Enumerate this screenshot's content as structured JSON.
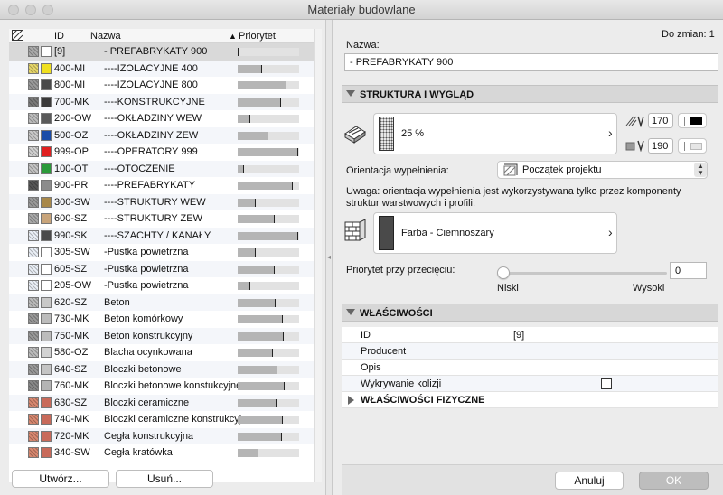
{
  "window": {
    "title": "Materiały budowlane"
  },
  "list": {
    "header": {
      "id": "ID",
      "name": "Nazwa",
      "priority": "Priorytet",
      "sort_arrow": "▲"
    },
    "rows": [
      {
        "sw1": "#aaaaaa",
        "sw2": "#ffffff",
        "id": "[9]",
        "name": "- PREFABRYKATY 900",
        "p": 0.02,
        "selected": true
      },
      {
        "sw1": "#e6d66a",
        "sw2": "#f0e020",
        "id": "400-MI",
        "name": "----IZOLACYJNE 400",
        "p": 0.4
      },
      {
        "sw1": "#9a9a9a",
        "sw2": "#4a4a4a",
        "id": "800-MI",
        "name": "----IZOLACYJNE 800",
        "p": 0.8
      },
      {
        "sw1": "#7a7a7a",
        "sw2": "#3a3a3a",
        "id": "700-MK",
        "name": "----KONSTRUKCYJNE",
        "p": 0.7
      },
      {
        "sw1": "#bcbcbc",
        "sw2": "#5a5a5a",
        "id": "200-OW",
        "name": "----OKŁADZINY WEW",
        "p": 0.2
      },
      {
        "sw1": "#c8c8c8",
        "sw2": "#1a4ca8",
        "id": "500-OZ",
        "name": "----OKŁADZINY ZEW",
        "p": 0.5
      },
      {
        "sw1": "#d0d0d0",
        "sw2": "#e02020",
        "id": "999-OP",
        "name": "----OPERATORY 999",
        "p": 0.99
      },
      {
        "sw1": "#c4c4c4",
        "sw2": "#2a9a3a",
        "id": "100-OT",
        "name": "----OTOCZENIE",
        "p": 0.1
      },
      {
        "sw1": "#555555",
        "sw2": "#8c8c8c",
        "id": "900-PR",
        "name": "----PREFABRYKATY",
        "p": 0.9
      },
      {
        "sw1": "#9a9a9a",
        "sw2": "#a8884a",
        "id": "300-SW",
        "name": "----STRUKTURY WEW",
        "p": 0.3
      },
      {
        "sw1": "#aaaaaa",
        "sw2": "#c8a47a",
        "id": "600-SZ",
        "name": "----STRUKTURY ZEW",
        "p": 0.6
      },
      {
        "sw1": "#eaeff6",
        "sw2": "#4a4a4a",
        "id": "990-SK",
        "name": "----SZACHTY / KANAŁY",
        "p": 0.99
      },
      {
        "sw1": "#eaeff6",
        "sw2": "#ffffff",
        "id": "305-SW",
        "name": "-Pustka powietrzna",
        "p": 0.3
      },
      {
        "sw1": "#eaeff6",
        "sw2": "#ffffff",
        "id": "605-SZ",
        "name": "-Pustka powietrzna",
        "p": 0.6
      },
      {
        "sw1": "#eaeff6",
        "sw2": "#ffffff",
        "id": "205-OW",
        "name": "-Pustka powietrzna",
        "p": 0.2
      },
      {
        "sw1": "#bbbbbb",
        "sw2": "#c8c8c8",
        "id": "620-SZ",
        "name": "Beton",
        "p": 0.62
      },
      {
        "sw1": "#999999",
        "sw2": "#bcbcbc",
        "id": "730-MK",
        "name": "Beton komórkowy",
        "p": 0.73
      },
      {
        "sw1": "#999999",
        "sw2": "#bcbcbc",
        "id": "750-MK",
        "name": "Beton konstrukcyjny",
        "p": 0.75
      },
      {
        "sw1": "#bdbdbd",
        "sw2": "#d2d2d2",
        "id": "580-OZ",
        "name": "Blacha ocynkowana",
        "p": 0.58
      },
      {
        "sw1": "#9a9a9a",
        "sw2": "#c4c4c4",
        "id": "640-SZ",
        "name": "Bloczki betonowe",
        "p": 0.64
      },
      {
        "sw1": "#888888",
        "sw2": "#b4b4b4",
        "id": "760-MK",
        "name": "Bloczki betonowe konstukcyjne",
        "p": 0.76
      },
      {
        "sw1": "#d88870",
        "sw2": "#c86a5a",
        "id": "630-SZ",
        "name": "Bloczki ceramiczne",
        "p": 0.63
      },
      {
        "sw1": "#d88870",
        "sw2": "#c86a5a",
        "id": "740-MK",
        "name": "Bloczki ceramiczne konstrukcyjne",
        "p": 0.74
      },
      {
        "sw1": "#d88870",
        "sw2": "#c86a5a",
        "id": "720-MK",
        "name": "Cegła konstrukcyjna",
        "p": 0.72
      },
      {
        "sw1": "#d88870",
        "sw2": "#c86a5a",
        "id": "340-SW",
        "name": "Cegła kratówka",
        "p": 0.34
      }
    ]
  },
  "buttons": {
    "create": "Utwórz...",
    "delete": "Usuń...",
    "cancel": "Anuluj",
    "ok": "OK"
  },
  "details": {
    "changes": "Do zmian: 1",
    "name_label": "Nazwa:",
    "name_value": "- PREFABRYKATY 900",
    "section_structure": "STRUKTURA I WYGLĄD",
    "fill_percent": "25 %",
    "pen1": "170",
    "pen2": "190",
    "orientation_label": "Orientacja wypełnienia:",
    "orientation_value": "Początek projektu",
    "note": "Uwaga: orientacja wypełnienia jest wykorzystywana tylko przez komponenty struktur warstwowych i profili.",
    "surface_value": "Farba - Ciemnoszary",
    "priority_label": "Priorytet przy przecięciu:",
    "priority_value": "0",
    "slider_low": "Niski",
    "slider_high": "Wysoki",
    "slider_level": 0.0,
    "section_props": "WŁAŚCIWOŚCI",
    "props": [
      {
        "label": "ID",
        "value": "[9]"
      },
      {
        "label": "Producent",
        "value": ""
      },
      {
        "label": "Opis",
        "value": ""
      },
      {
        "label": "Wykrywanie kolizji",
        "value": ""
      }
    ],
    "section_physical": "WŁAŚCIWOŚCI FIZYCZNE"
  }
}
